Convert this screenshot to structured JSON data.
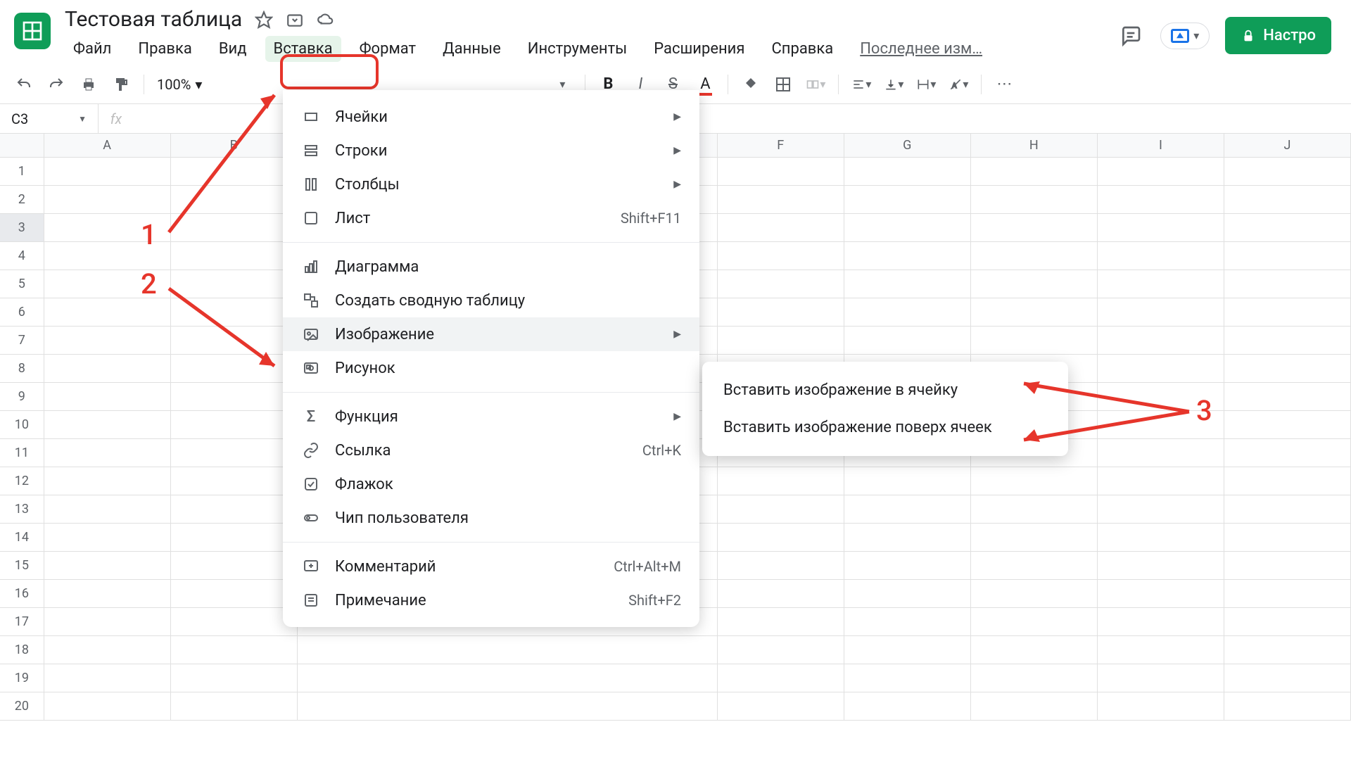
{
  "doc": {
    "title": "Тестовая таблица"
  },
  "menubar": {
    "items": [
      "Файл",
      "Правка",
      "Вид",
      "Вставка",
      "Формат",
      "Данные",
      "Инструменты",
      "Расширения",
      "Справка"
    ],
    "lastedit": "Последнее изм…"
  },
  "share_label": "Настро",
  "toolbar": {
    "zoom": "100%"
  },
  "namebox": "C3",
  "columns": [
    "A",
    "B",
    "F",
    "G",
    "H",
    "I",
    "J"
  ],
  "rows_count": 20,
  "selected_row": 3,
  "dropdown": {
    "groups": [
      [
        {
          "icon": "cells",
          "label": "Ячейки",
          "arrow": true
        },
        {
          "icon": "rows",
          "label": "Строки",
          "arrow": true
        },
        {
          "icon": "cols",
          "label": "Столбцы",
          "arrow": true
        },
        {
          "icon": "sheet",
          "label": "Лист",
          "shortcut": "Shift+F11"
        }
      ],
      [
        {
          "icon": "chart",
          "label": "Диаграмма"
        },
        {
          "icon": "pivot",
          "label": "Создать сводную таблицу"
        },
        {
          "icon": "image",
          "label": "Изображение",
          "arrow": true,
          "hover": true
        },
        {
          "icon": "drawing",
          "label": "Рисунок"
        }
      ],
      [
        {
          "icon": "sigma",
          "label": "Функция",
          "arrow": true
        },
        {
          "icon": "link",
          "label": "Ссылка",
          "shortcut": "Ctrl+K"
        },
        {
          "icon": "checkbox",
          "label": "Флажок"
        },
        {
          "icon": "chip",
          "label": "Чип пользователя"
        }
      ],
      [
        {
          "icon": "comment",
          "label": "Комментарий",
          "shortcut": "Ctrl+Alt+M"
        },
        {
          "icon": "note",
          "label": "Примечание",
          "shortcut": "Shift+F2"
        }
      ]
    ]
  },
  "submenu": {
    "items": [
      "Вставить изображение в ячейку",
      "Вставить изображение поверх ячеек"
    ]
  },
  "annotations": {
    "n1": "1",
    "n2": "2",
    "n3": "3"
  }
}
